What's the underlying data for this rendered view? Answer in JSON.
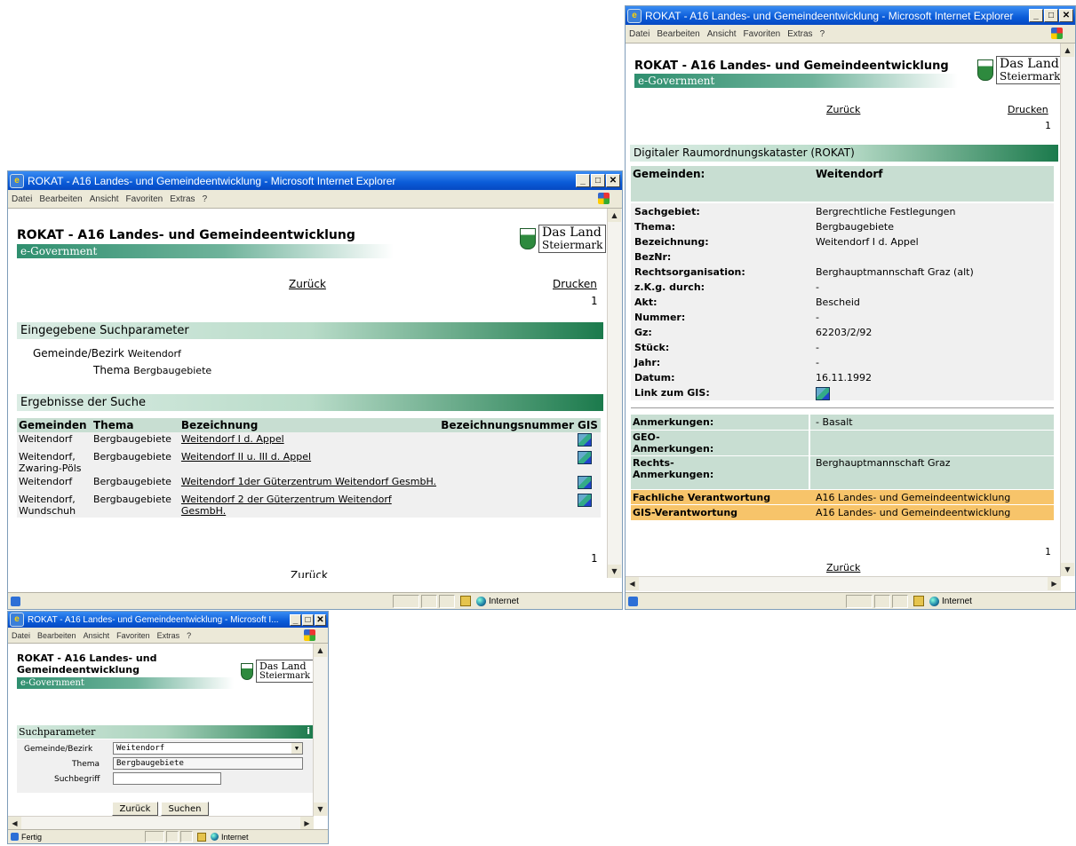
{
  "browser": {
    "window_title": "ROKAT - A16 Landes- und Gemeindeentwicklung - Microsoft Internet Explorer",
    "window_title_short": "ROKAT - A16 Landes- und Gemeindeentwicklung - Microsoft I...",
    "menu": [
      "Datei",
      "Bearbeiten",
      "Ansicht",
      "Favoriten",
      "Extras",
      "?"
    ],
    "status_zone": "Internet",
    "status_done": "Fertig"
  },
  "header": {
    "title": "ROKAT - A16 Landes- und Gemeindeentwicklung",
    "title_line1": "ROKAT - A16 Landes- und",
    "title_line2": "Gemeindeentwicklung",
    "egov": "e-Government",
    "logo_line1": "Das Land",
    "logo_line2": "Steiermark"
  },
  "nav": {
    "back": "Zurück",
    "print": "Drucken",
    "page": "1"
  },
  "results_window": {
    "params_title": "Eingegebene Suchparameter",
    "param_gemeinde_label": "Gemeinde/Bezirk",
    "param_gemeinde_value": "Weitendorf",
    "param_thema_label": "Thema",
    "param_thema_value": "Bergbaugebiete",
    "results_title": "Ergebnisse der Suche",
    "columns": [
      "Gemeinden",
      "Thema",
      "Bezeichnung",
      "Bezeichnungsnummer",
      "GIS"
    ],
    "rows": [
      {
        "gemeinde": "Weitendorf",
        "thema": "Bergbaugebiete",
        "bezeichnung": "Weitendorf I d. Appel",
        "nummer": ""
      },
      {
        "gemeinde": "Weitendorf, Zwaring-Pöls",
        "thema": "Bergbaugebiete",
        "bezeichnung": "Weitendorf II u. III d. Appel",
        "nummer": ""
      },
      {
        "gemeinde": "Weitendorf",
        "thema": "Bergbaugebiete",
        "bezeichnung": "Weitendorf 1der Güterzentrum Weitendorf GesmbH.",
        "nummer": ""
      },
      {
        "gemeinde": "Weitendorf, Wundschuh",
        "thema": "Bergbaugebiete",
        "bezeichnung": "Weitendorf 2 der Güterzentrum Weitendorf GesmbH.",
        "nummer": ""
      }
    ]
  },
  "detail_window": {
    "section_title": "Digitaler Raumordnungskataster (ROKAT)",
    "head_label": "Gemeinden:",
    "head_value": "Weitendorf",
    "fields": [
      {
        "label": "Sachgebiet:",
        "value": "Bergrechtliche Festlegungen"
      },
      {
        "label": "Thema:",
        "value": "Bergbaugebiete"
      },
      {
        "label": "Bezeichnung:",
        "value": "Weitendorf I d. Appel"
      },
      {
        "label": "BezNr:",
        "value": ""
      },
      {
        "label": "Rechtsorganisation:",
        "value": "Berghauptmannschaft Graz (alt)"
      },
      {
        "label": "z.K.g. durch:",
        "value": "-"
      },
      {
        "label": "Akt:",
        "value": "Bescheid"
      },
      {
        "label": "Nummer:",
        "value": "-"
      },
      {
        "label": "Gz:",
        "value": "62203/2/92"
      },
      {
        "label": "Stück:",
        "value": "-"
      },
      {
        "label": "Jahr:",
        "value": "-"
      },
      {
        "label": "Datum:",
        "value": "16.11.1992"
      },
      {
        "label": "Link zum GIS:",
        "value": ""
      }
    ],
    "notes": [
      {
        "label": "Anmerkungen:",
        "value": "- Basalt"
      },
      {
        "label": "GEO-Anmerkungen:",
        "value": ""
      },
      {
        "label": "Rechts-Anmerkungen:",
        "value": "Berghauptmannschaft Graz"
      }
    ],
    "responsible": [
      {
        "label": "Fachliche Verantwortung",
        "value": "A16 Landes- und Gemeindeentwicklung"
      },
      {
        "label": "GIS-Verantwortung",
        "value": "A16 Landes- und Gemeindeentwicklung"
      }
    ]
  },
  "search_window": {
    "section_title": "Suchparameter",
    "info": "i",
    "gemeinde_label": "Gemeinde/Bezirk",
    "gemeinde_value": "Weitendorf",
    "thema_label": "Thema",
    "thema_value": "Bergbaugebiete",
    "suchbegriff_label": "Suchbegriff",
    "suchbegriff_value": "",
    "back_button": "Zurück",
    "search_button": "Suchen"
  },
  "colors": {
    "titlebar": "#0a5bd8",
    "section_green": "#1b7a4c",
    "highlight_orange": "#f7c46a",
    "row_green": "#c8ded2"
  }
}
